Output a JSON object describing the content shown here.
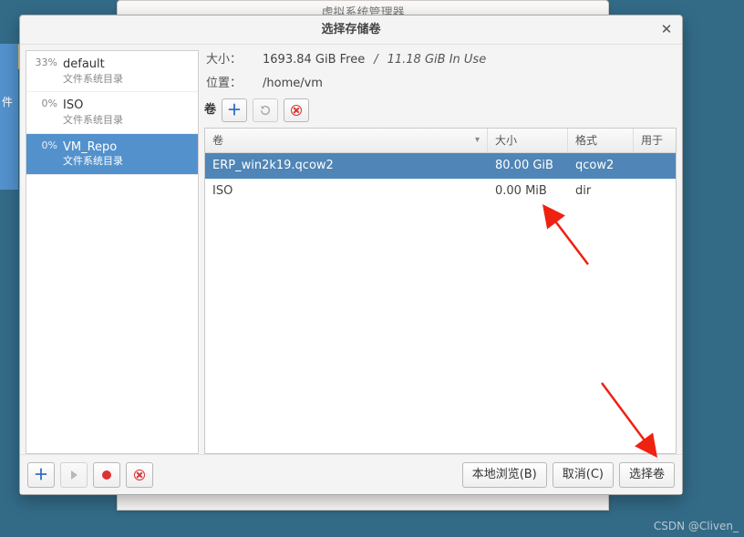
{
  "backdrop": {
    "parent_window_title": "虚拟系统管理器",
    "side_tab": "件"
  },
  "dialog": {
    "title": "选择存储卷",
    "close_glyph": "✕"
  },
  "pools": [
    {
      "name": "default",
      "sub": "文件系统目录",
      "pct": "33%",
      "selected": false
    },
    {
      "name": "ISO",
      "sub": "文件系统目录",
      "pct": "0%",
      "selected": false
    },
    {
      "name": "VM_Repo",
      "sub": "文件系统目录",
      "pct": "0%",
      "selected": true
    }
  ],
  "info": {
    "size_label": "大小：",
    "size_free": "1693.84 GiB Free",
    "size_sep": " / ",
    "size_used_italic": "11.18 GiB In Use",
    "loc_label": "位置：",
    "loc_value": "/home/vm",
    "vol_label": "卷"
  },
  "vol_toolbar_icons": {
    "add": "plus-icon",
    "refresh": "refresh-icon",
    "delete": "delete-icon"
  },
  "vol_table": {
    "cols": {
      "name": "卷",
      "size": "大小",
      "fmt": "格式",
      "used": "用于"
    },
    "rows": [
      {
        "name": "ERP_win2k19.qcow2",
        "size": "80.00 GiB",
        "fmt": "qcow2",
        "used": "",
        "selected": true
      },
      {
        "name": "ISO",
        "size": "0.00 MiB",
        "fmt": "dir",
        "used": "",
        "selected": false
      }
    ]
  },
  "bottom_buttons": {
    "browse": "本地浏览(B)",
    "cancel": "取消(C)",
    "choose": "选择卷"
  },
  "watermark": "CSDN @Cliven_"
}
